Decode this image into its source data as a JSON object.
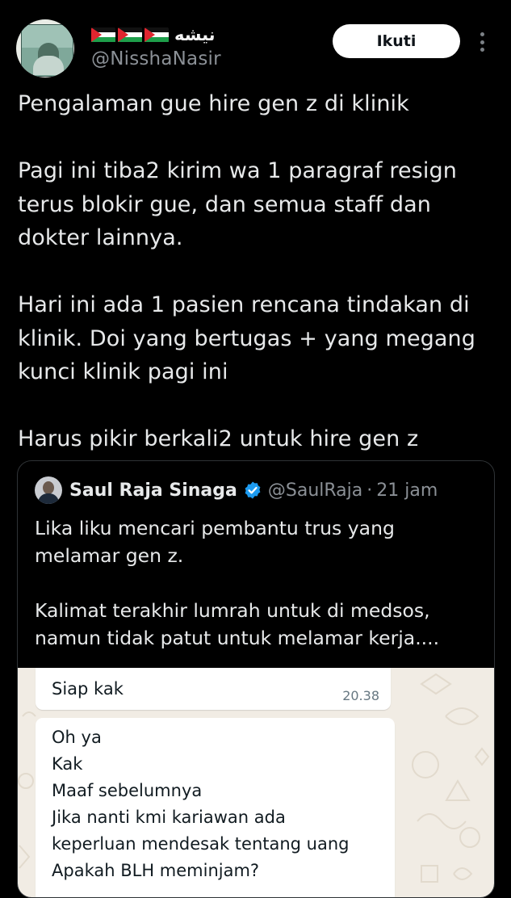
{
  "author": {
    "display_name": "نيشه",
    "flag_icon": "palestine-flag-icon",
    "flag_count": 3,
    "handle": "@NisshaNasir"
  },
  "follow_button": {
    "label": "Ikuti"
  },
  "more_icon": "vertical-ellipsis-icon",
  "tweet": {
    "paragraphs": [
      [
        "Pengalaman gue hire gen z di klinik"
      ],
      [
        "Pagi ini tiba2 kirim wa 1 paragraf resign",
        "terus blokir gue, dan semua staff dan",
        "dokter lainnya."
      ],
      [
        "Hari ini ada 1 pasien rencana tindakan di",
        "klinik. Doi yang bertugas + yang megang",
        "kunci klinik pagi ini"
      ],
      [
        "Harus pikir berkali2 untuk hire gen z"
      ]
    ]
  },
  "quote": {
    "author_name": "Saul Raja Sinaga",
    "verified_icon": "verified-badge-icon",
    "handle": "@SaulRaja",
    "separator": "·",
    "time": "21 jam",
    "paragraphs": [
      [
        "Lika liku mencari pembantu trus yang",
        "melamar gen z."
      ],
      [
        "Kalimat terakhir lumrah untuk di medsos,",
        "namun tidak patut untuk melamar kerja...."
      ]
    ],
    "chat_screenshot": {
      "messages": [
        {
          "text": "Siap kak",
          "time": "20.38"
        },
        {
          "lines": [
            "Oh ya",
            "Kak",
            "Maaf sebelumnya",
            "Jika nanti kmi kariawan ada",
            "keperluan mendesak tentang uang",
            "Apakah BLH meminjam?"
          ]
        }
      ]
    }
  },
  "colors": {
    "background": "#000000",
    "text_primary": "#e7e9ea",
    "text_secondary": "#8b9096",
    "verified_blue": "#1d9bf0",
    "quote_border": "#2f3336",
    "chat_background": "#f1ece4"
  }
}
